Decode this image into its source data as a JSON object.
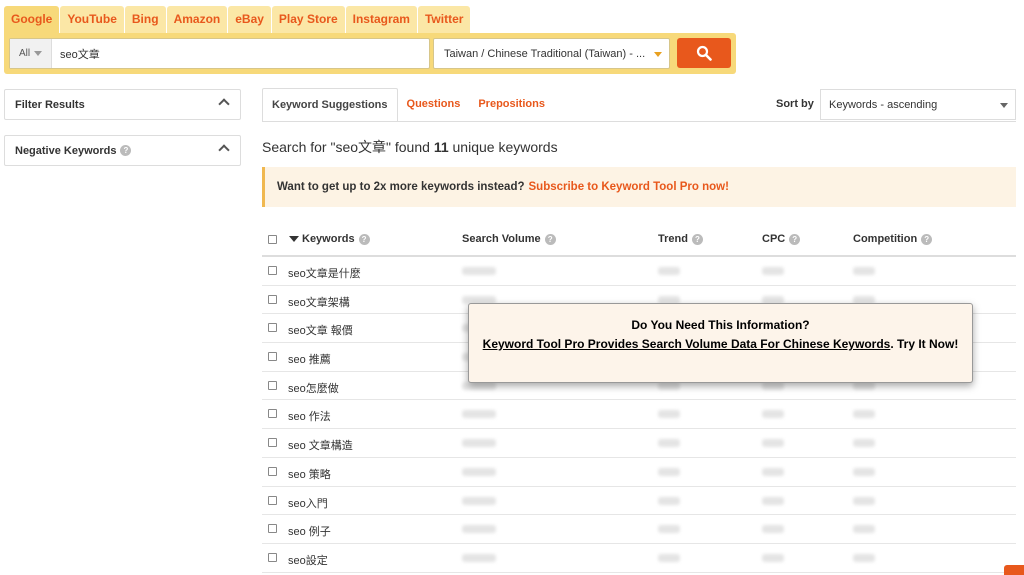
{
  "engines": [
    "Google",
    "YouTube",
    "Bing",
    "Amazon",
    "eBay",
    "Play Store",
    "Instagram",
    "Twitter"
  ],
  "search": {
    "scope": "All",
    "query": "seo文章",
    "language": "Taiwan / Chinese Traditional (Taiwan) - ...",
    "button_icon": "search-icon"
  },
  "sidebar": {
    "filter_results": "Filter Results",
    "negative_keywords": "Negative Keywords"
  },
  "results_tabs": [
    "Keyword Suggestions",
    "Questions",
    "Prepositions"
  ],
  "sort": {
    "label": "Sort by",
    "value": "Keywords - ascending"
  },
  "summary": {
    "prefix": "Search for \"seo文章\" found",
    "count": "11",
    "suffix": "unique keywords"
  },
  "promo": {
    "text": "Want to get up to 2x more keywords instead?",
    "link": "Subscribe to Keyword Tool Pro now!"
  },
  "table": {
    "columns": [
      "Keywords",
      "Search Volume",
      "Trend",
      "CPC",
      "Competition"
    ],
    "rows": [
      "seo文章是什麼",
      "seo文章架構",
      "seo文章 報價",
      "seo 推薦",
      "seo怎麼做",
      "seo 作法",
      "seo 文章構造",
      "seo 策略",
      "seo入門",
      "seo 例子",
      "seo設定"
    ]
  },
  "popup": {
    "title": "Do You Need This Information?",
    "link": "Keyword Tool Pro Provides Search Volume Data For Chinese Keywords",
    "tail": ". Try It Now!"
  },
  "colors": {
    "accent": "#e8581c",
    "tab_bg": "#fbe7a6",
    "strip_bg": "#f7d97a",
    "promo_bg": "#fdf3e4"
  }
}
